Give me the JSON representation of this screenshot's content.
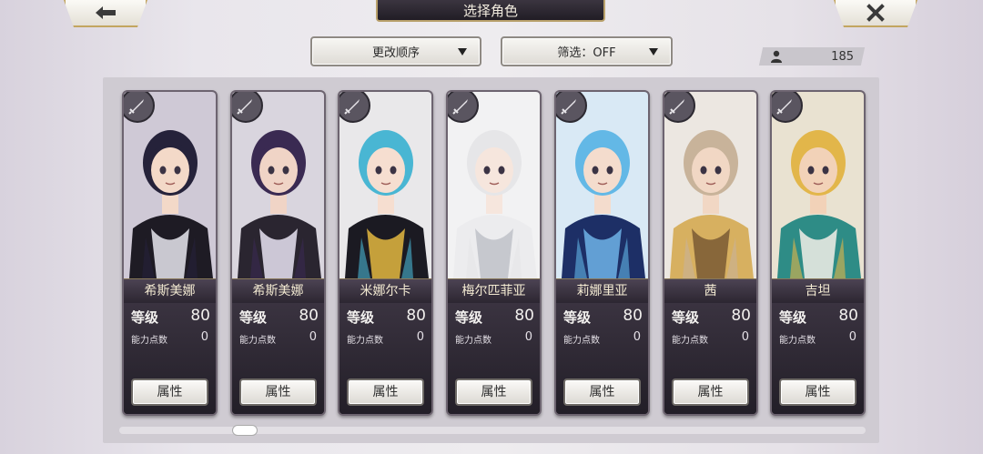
{
  "header": {
    "title": "选择角色",
    "back_icon": "back-arrow-icon",
    "close_icon": "close-x-icon"
  },
  "controls": {
    "sort_label": "更改顺序",
    "filter_label": "筛选：OFF",
    "player_count": "185",
    "count_icon": "person-icon"
  },
  "colors": {
    "gold_border": "#c3a660",
    "card_bg": "#221e27",
    "text_light": "#f3ead2"
  },
  "characters": [
    {
      "name": "希斯美娜",
      "level_label": "等级",
      "level": "80",
      "points_label": "能力点数",
      "points": "0",
      "button": "属性",
      "hair": "#25223a",
      "skin": "#f3d9c8",
      "outfit": "#1e1b24",
      "accent": "#e8e6ef",
      "bg": "#cfc9d6"
    },
    {
      "name": "希斯美娜",
      "level_label": "等级",
      "level": "80",
      "points_label": "能力点数",
      "points": "0",
      "button": "属性",
      "hair": "#3a2a52",
      "skin": "#f0d4c6",
      "outfit": "#2a2530",
      "accent": "#e9e4f3",
      "bg": "#d9d5de"
    },
    {
      "name": "米娜尔卡",
      "level_label": "等级",
      "level": "80",
      "points_label": "能力点数",
      "points": "0",
      "button": "属性",
      "hair": "#49b6d3",
      "skin": "#f6ded0",
      "outfit": "#1b1a22",
      "accent": "#e3b840",
      "bg": "#e9e8ea"
    },
    {
      "name": "梅尔匹菲亚",
      "level_label": "等级",
      "level": "80",
      "points_label": "能力点数",
      "points": "0",
      "button": "属性",
      "hair": "#e6e6e8",
      "skin": "#f6e6dd",
      "outfit": "#ececee",
      "accent": "#bfc2c8",
      "bg": "#f2f2f3"
    },
    {
      "name": "莉娜里亚",
      "level_label": "等级",
      "level": "80",
      "points_label": "能力点数",
      "points": "0",
      "button": "属性",
      "hair": "#63b8e6",
      "skin": "#f4dccd",
      "outfit": "#1d2f66",
      "accent": "#6fb3e8",
      "bg": "#d9e9f5"
    },
    {
      "name": "茜",
      "level_label": "等级",
      "level": "80",
      "points_label": "能力点数",
      "points": "0",
      "button": "属性",
      "hair": "#c8b39a",
      "skin": "#f1d7c4",
      "outfit": "#d7b060",
      "accent": "#7a5a34",
      "bg": "#ece7e1"
    },
    {
      "name": "吉坦",
      "level_label": "等级",
      "level": "80",
      "points_label": "能力点数",
      "points": "0",
      "button": "属性",
      "hair": "#e2b64a",
      "skin": "#f2d2b8",
      "outfit": "#2e8c86",
      "accent": "#f2efe8",
      "bg": "#e9e2d1"
    }
  ]
}
